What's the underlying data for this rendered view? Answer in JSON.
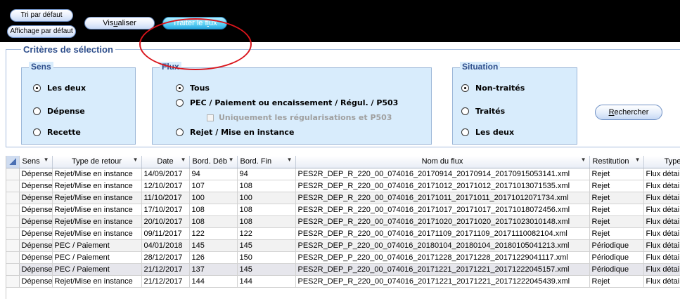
{
  "toolbar": {
    "sort_default": "Tri par défaut",
    "display_default": "Affichage par défaut",
    "visualize_pre": "Vis",
    "visualize_u": "u",
    "visualize_post": "aliser",
    "process_pre": "Traiter le f",
    "process_u": "l",
    "process_post": "ux"
  },
  "criteria": {
    "title": "Critères de sélection",
    "sens": {
      "title": "Sens",
      "options": [
        "Les deux",
        "Dépense",
        "Recette"
      ],
      "selected": "Les deux"
    },
    "flux": {
      "title": "Flux",
      "options": [
        "Tous",
        "PEC / Paiement ou encaissement / Régul. / P503",
        "Rejet / Mise en instance"
      ],
      "checkbox_label": "Uniquement les régularisations et P503",
      "selected": "Tous"
    },
    "situation": {
      "title": "Situation",
      "options": [
        "Non-traités",
        "Traités",
        "Les deux"
      ],
      "selected": "Non-traités"
    },
    "search_pre": "",
    "search_u": "R",
    "search_post": "echercher"
  },
  "table": {
    "columns": [
      "Sens",
      "Type de retour",
      "Date",
      "Bord. Déb",
      "Bord. Fin",
      "Nom du flux",
      "Restitution",
      "Type"
    ],
    "rows": [
      [
        "Dépense",
        "Rejet/Mise en instance",
        "14/09/2017",
        "94",
        "94",
        "PES2R_DEP_R_220_00_074016_20170914_20170914_20170915053141.xml",
        "Rejet",
        "Flux détai"
      ],
      [
        "Dépense",
        "Rejet/Mise en instance",
        "12/10/2017",
        "107",
        "108",
        "PES2R_DEP_R_220_00_074016_20171012_20171012_20171013071535.xml",
        "Rejet",
        "Flux détai"
      ],
      [
        "Dépense",
        "Rejet/Mise en instance",
        "11/10/2017",
        "100",
        "100",
        "PES2R_DEP_R_220_00_074016_20171011_20171011_20171012071734.xml",
        "Rejet",
        "Flux détai"
      ],
      [
        "Dépense",
        "Rejet/Mise en instance",
        "17/10/2017",
        "108",
        "108",
        "PES2R_DEP_R_220_00_074016_20171017_20171017_20171018072456.xml",
        "Rejet",
        "Flux détai"
      ],
      [
        "Dépense",
        "Rejet/Mise en instance",
        "20/10/2017",
        "108",
        "108",
        "PES2R_DEP_R_220_00_074016_20171020_20171020_20171023010148.xml",
        "Rejet",
        "Flux détai"
      ],
      [
        "Dépense",
        "Rejet/Mise en instance",
        "09/11/2017",
        "122",
        "122",
        "PES2R_DEP_R_220_00_074016_20171109_20171109_20171110082104.xml",
        "Rejet",
        "Flux détai"
      ],
      [
        "Dépense",
        "PEC / Paiement",
        "04/01/2018",
        "145",
        "145",
        "PES2R_DEP_P_220_00_074016_20180104_20180104_20180105041213.xml",
        "Périodique",
        "Flux détai"
      ],
      [
        "Dépense",
        "PEC / Paiement",
        "28/12/2017",
        "126",
        "150",
        "PES2R_DEP_P_220_00_074016_20171228_20171228_20171229041117.xml",
        "Périodique",
        "Flux détai"
      ],
      [
        "Dépense",
        "PEC / Paiement",
        "21/12/2017",
        "137",
        "145",
        "PES2R_DEP_P_220_00_074016_20171221_20171221_20171222045157.xml",
        "Périodique",
        "Flux détai"
      ],
      [
        "Dépense",
        "Rejet/Mise en instance",
        "21/12/2017",
        "144",
        "144",
        "PES2R_DEP_R_220_00_074016_20171221_20171221_20171222045439.xml",
        "Rejet",
        "Flux détai"
      ]
    ]
  },
  "colors": {
    "toolbar_bg": "#000000",
    "panel_bg": "#d8ecfc",
    "annotation": "#d9141b",
    "legend_text": "#2f4f8c"
  }
}
